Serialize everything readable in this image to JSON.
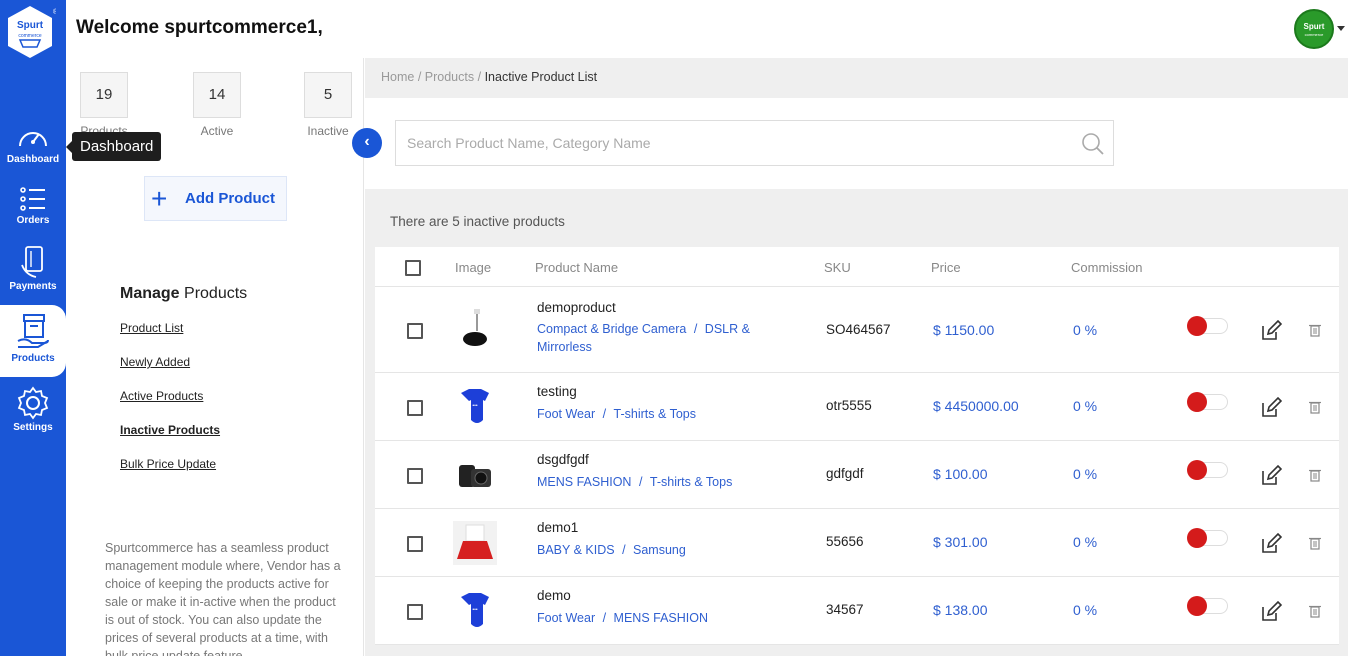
{
  "header": {
    "welcome": "Welcome spurtcommerce1,"
  },
  "logo": {
    "line1": "Spurt",
    "line2": "commerce",
    "mark": "®"
  },
  "avatar": {
    "line1": "Spurt",
    "line2": "commerce"
  },
  "nav": {
    "dashboard": "Dashboard",
    "orders": "Orders",
    "payments": "Payments",
    "products": "Products",
    "settings": "Settings",
    "tooltip": "Dashboard"
  },
  "stats": [
    {
      "value": "19",
      "label": "Products"
    },
    {
      "value": "14",
      "label": "Active"
    },
    {
      "value": "5",
      "label": "Inactive"
    }
  ],
  "panel": {
    "add_product": "Add Product",
    "manage_title_bold": "Manage",
    "manage_title_rest": " Products",
    "links": {
      "product_list": "Product List",
      "newly_added": "Newly Added",
      "active_products": "Active Products",
      "inactive_products": "Inactive Products",
      "bulk_price_update": "Bulk Price Update"
    },
    "about": "Spurtcommerce has a seamless product management module where, Vendor has a choice of keeping the products active for sale or make it in-active when the product is out of stock. You can also update the prices of several products at a time, with bulk price update feature."
  },
  "breadcrumb": {
    "home": "Home",
    "products": "Products",
    "current": "Inactive Product List"
  },
  "search": {
    "placeholder": "Search Product Name, Category Name"
  },
  "summary": "There are 5 inactive products",
  "table": {
    "headers": {
      "image": "Image",
      "name": "Product Name",
      "sku": "SKU",
      "price": "Price",
      "commission": "Commission"
    },
    "rows": [
      {
        "name": "demoproduct",
        "cat1": "Compact & Bridge Camera",
        "cat2": "DSLR & Mirrorless",
        "sku": "SO464567",
        "price": "$ 1150.00",
        "commission": "0 %",
        "image": "guitar"
      },
      {
        "name": "testing",
        "cat1": "Foot Wear",
        "cat2": "T-shirts & Tops",
        "sku": "otr5555",
        "price": "$ 4450000.00",
        "commission": "0 %",
        "image": "onesie"
      },
      {
        "name": "dsgdfgdf",
        "cat1": "MENS FASHION",
        "cat2": "T-shirts & Tops",
        "sku": "gdfgdf",
        "price": "$ 100.00",
        "commission": "0 %",
        "image": "camera"
      },
      {
        "name": "demo1",
        "cat1": "BABY & KIDS",
        "cat2": "Samsung",
        "sku": "55656",
        "price": "$ 301.00",
        "commission": "0 %",
        "image": "dress"
      },
      {
        "name": "demo",
        "cat1": "Foot Wear",
        "cat2": "MENS FASHION",
        "sku": "34567",
        "price": "$ 138.00",
        "commission": "0 %",
        "image": "onesie"
      }
    ]
  },
  "colors": {
    "primary": "#1a56d6",
    "link": "#2f5fd0",
    "toggle_off": "#d41b1b"
  }
}
